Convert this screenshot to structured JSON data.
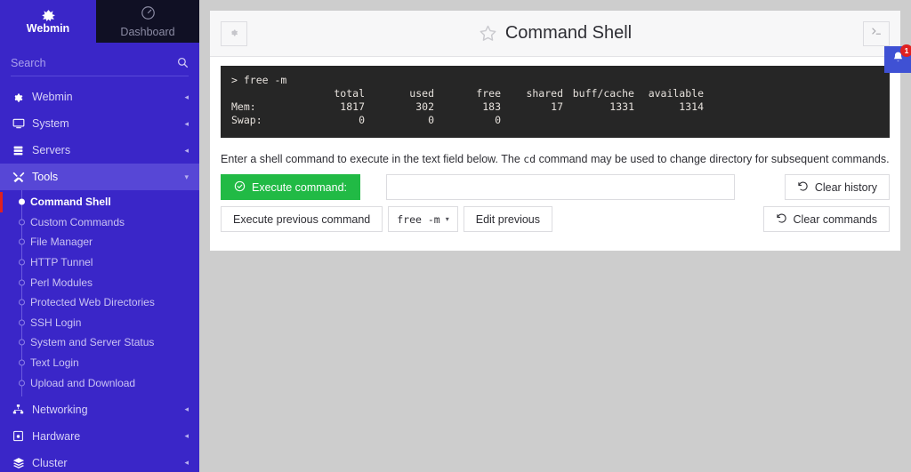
{
  "sidebar": {
    "brand": {
      "name": "Webmin",
      "logo_icon": "webmin-logo-icon"
    },
    "dashboard_tab": {
      "label": "Dashboard",
      "icon": "gauge-icon"
    },
    "search": {
      "placeholder": "Search",
      "value": "",
      "icon": "search-icon"
    },
    "nav": [
      {
        "label": "Webmin",
        "icon": "gear-icon",
        "caret": "◂",
        "active": false
      },
      {
        "label": "System",
        "icon": "monitor-icon",
        "caret": "◂",
        "active": false
      },
      {
        "label": "Servers",
        "icon": "servers-icon",
        "caret": "◂",
        "active": false
      },
      {
        "label": "Tools",
        "icon": "wrench-icon",
        "caret": "▾",
        "active": true
      }
    ],
    "submenu": [
      {
        "label": "Command Shell",
        "active": true
      },
      {
        "label": "Custom Commands",
        "active": false
      },
      {
        "label": "File Manager",
        "active": false
      },
      {
        "label": "HTTP Tunnel",
        "active": false
      },
      {
        "label": "Perl Modules",
        "active": false
      },
      {
        "label": "Protected Web Directories",
        "active": false
      },
      {
        "label": "SSH Login",
        "active": false
      },
      {
        "label": "System and Server Status",
        "active": false
      },
      {
        "label": "Text Login",
        "active": false
      },
      {
        "label": "Upload and Download",
        "active": false
      }
    ],
    "nav_bottom": [
      {
        "label": "Networking",
        "icon": "sitemap-icon",
        "caret": "◂"
      },
      {
        "label": "Hardware",
        "icon": "harddrive-icon",
        "caret": "◂"
      },
      {
        "label": "Cluster",
        "icon": "layers-icon",
        "caret": "◂"
      }
    ],
    "colors": {
      "background": "#3a26c8",
      "active": "#5747d6",
      "accent": "#e02020",
      "dashboard_bg": "#101024"
    }
  },
  "header": {
    "title": "Command Shell",
    "star_icon": "star-outline-icon",
    "gear_button_icon": "gear-icon",
    "terminal_button_icon": "terminal-prompt-icon"
  },
  "notification": {
    "icon": "bell-icon",
    "count": "1",
    "badge_color": "#e02020",
    "button_color": "#3f51d4"
  },
  "terminal": {
    "prompt_line": "> free -m",
    "header_label": "",
    "columns": [
      "total",
      "used",
      "free",
      "shared",
      "buff/cache",
      "available"
    ],
    "rows": [
      {
        "label": "Mem:",
        "values": [
          "1817",
          "302",
          "183",
          "17",
          "1331",
          "1314"
        ]
      },
      {
        "label": "Swap:",
        "values": [
          "0",
          "0",
          "0",
          "",
          "",
          ""
        ]
      }
    ],
    "background": "#262626"
  },
  "form": {
    "instructions_part1": "Enter a shell command to execute in the text field below. The ",
    "instructions_code": "cd",
    "instructions_part2": " command may be used to change directory for subsequent commands.",
    "execute_label": "Execute command:",
    "execute_icon": "check-circle-icon",
    "execute_color": "#21ba45",
    "command_input": {
      "value": "",
      "placeholder": ""
    },
    "clear_history_label": "Clear history",
    "clear_history_icon": "undo-icon",
    "execute_previous_label": "Execute previous command",
    "previous_command_value": "free -m",
    "previous_command_caret": "▾",
    "edit_previous_label": "Edit previous",
    "clear_commands_label": "Clear commands",
    "clear_commands_icon": "undo-icon"
  }
}
